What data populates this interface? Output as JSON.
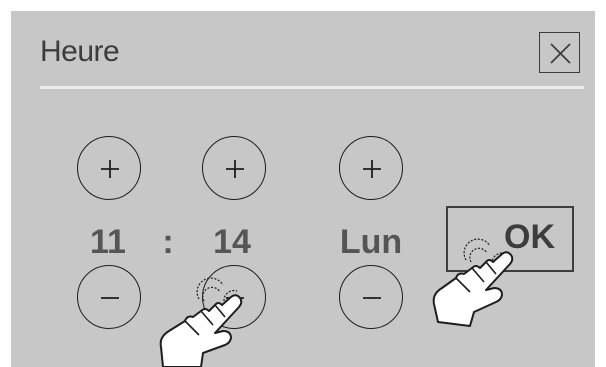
{
  "dialog": {
    "title": "Heure",
    "close_icon": "close-icon"
  },
  "time": {
    "hours": "11",
    "separator": ":",
    "minutes": "14"
  },
  "day": {
    "value": "Lun"
  },
  "controls": {
    "increment_icon": "plus-icon",
    "decrement_icon": "minus-icon"
  },
  "ok_button": {
    "label": "OK"
  },
  "gesture_hints": [
    "touch-hand-icon",
    "touch-hand-icon"
  ],
  "colors": {
    "panel_background": "#c7c7c7",
    "divider": "#ececec",
    "text": "#3d3d3d",
    "value_text": "#555555"
  }
}
